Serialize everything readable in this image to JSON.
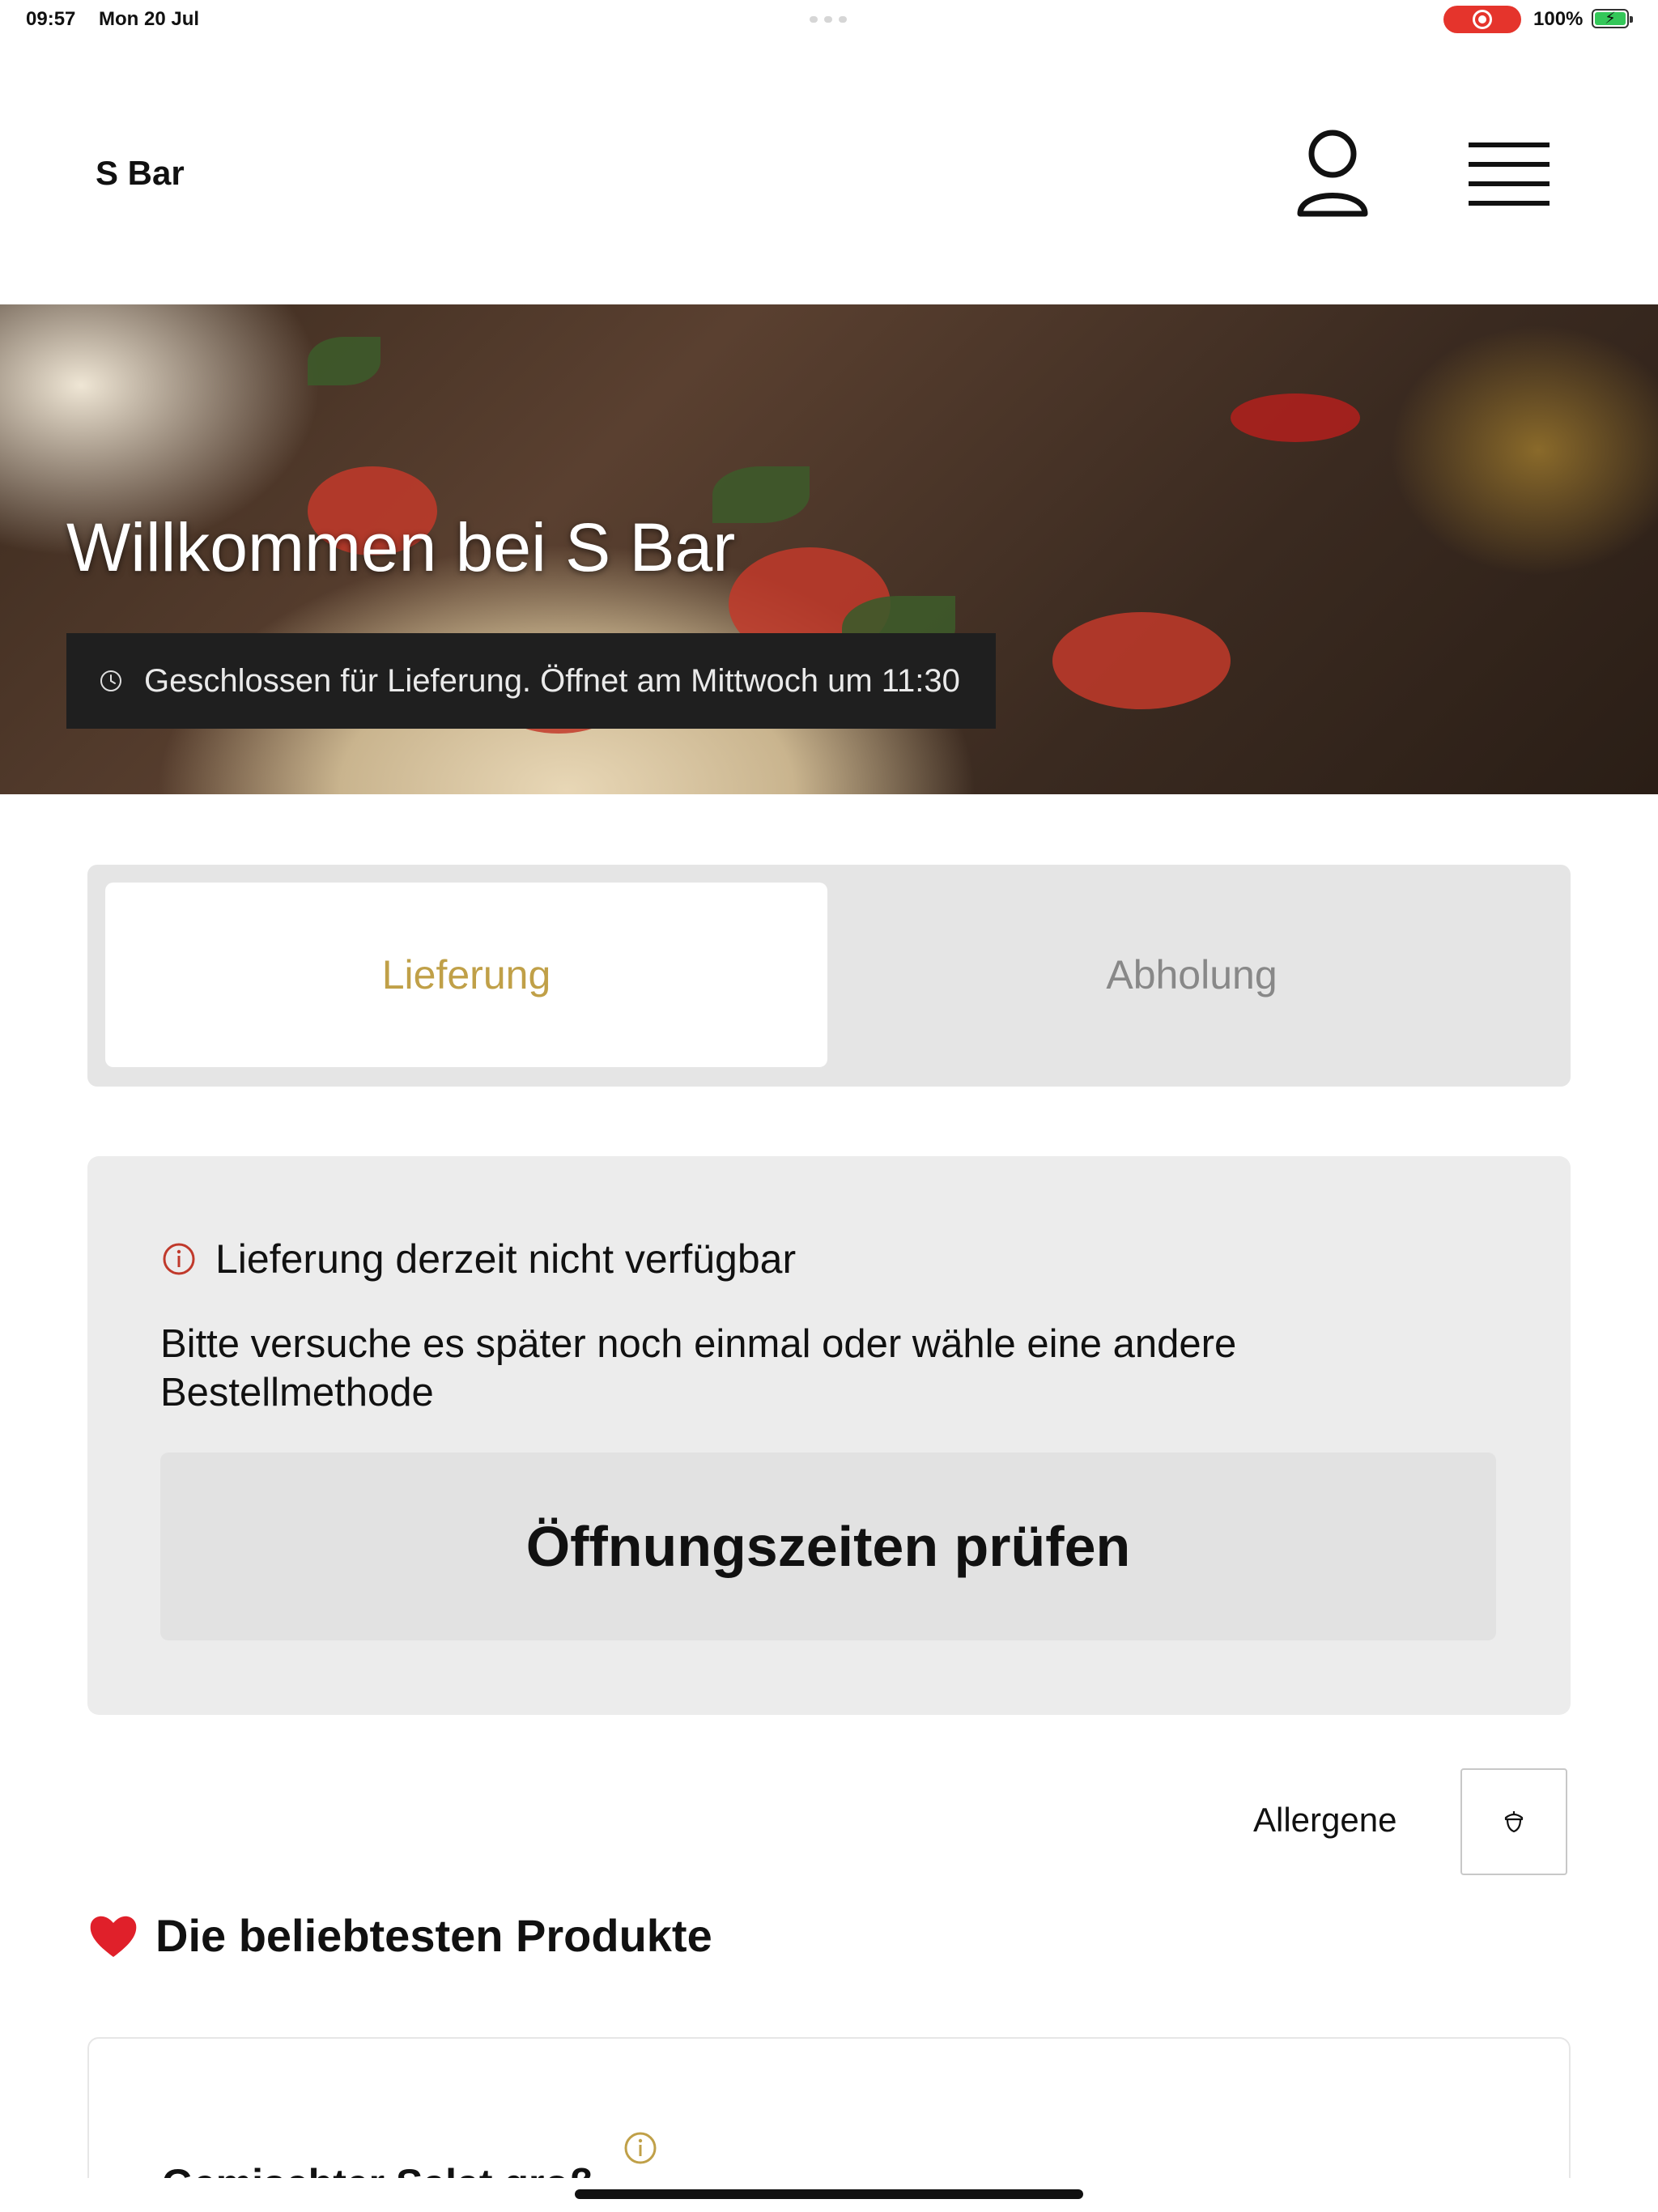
{
  "status_bar": {
    "time": "09:57",
    "date": "Mon 20 Jul",
    "battery": "100%"
  },
  "header": {
    "brand": "S Bar",
    "user_icon": "user-icon",
    "menu_icon": "hamburger-menu-icon"
  },
  "hero": {
    "title": "Willkommen bei S Bar",
    "notice": "Geschlossen für Lieferung. Öffnet am Mittwoch um 11:30",
    "notice_icon": "clock-icon"
  },
  "order_method": {
    "tabs": [
      {
        "label": "Lieferung",
        "active": true
      },
      {
        "label": "Abholung",
        "active": false
      }
    ],
    "accent_color": "#c0a048"
  },
  "unavailable_card": {
    "title": "Lieferung derzeit nicht verfügbar",
    "message": "Bitte versuche es später noch einmal oder wähle eine andere Bestellmethode",
    "button_label": "Öffnungszeiten prüfen",
    "info_icon": "info-icon",
    "info_color": "#c0392b"
  },
  "allergens": {
    "label": "Allergene",
    "icon": "acorn-icon"
  },
  "popular": {
    "title": "Die beliebtesten Produkte",
    "icon": "heart-icon",
    "products": [
      {
        "name": "Gemischter Salat groß",
        "info_icon": "info-icon"
      }
    ]
  }
}
